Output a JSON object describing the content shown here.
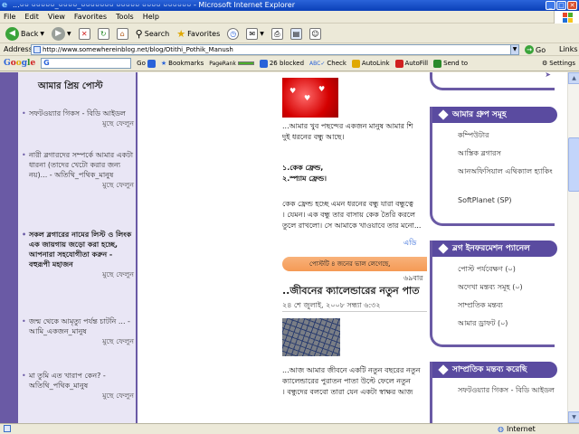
{
  "window": {
    "title": "...০০ ০০০০০_০০০০_০০০০০০০ ০০০০০ ০০০০ ০০০০০০ - Microsoft Internet Explorer",
    "minimize": "_",
    "maximize": "□",
    "close": "✕"
  },
  "menu": [
    "File",
    "Edit",
    "View",
    "Favorites",
    "Tools",
    "Help"
  ],
  "toolbar": {
    "back": "Back",
    "search": "Search",
    "favorites": "Favorites"
  },
  "address": {
    "label": "Address",
    "url": "http://www.somewhereinblog.net/blog/Otithi_Pothik_Manush",
    "go": "Go",
    "links": "Links"
  },
  "google_bar": {
    "logo": "Google",
    "search_letter": "G",
    "go": "Go",
    "bookmarks": "Bookmarks",
    "pagerank": "PageRank",
    "blocked": "26 blocked",
    "check": "Check",
    "autolink": "AutoLink",
    "autofill": "AutoFill",
    "sendto": "Send to",
    "settings": "Settings"
  },
  "left_sidebar": {
    "heading": "আমার প্রিয় পোস্ট",
    "delete_label": "মুছে ফেলুন",
    "items": [
      {
        "text": "সফটওয়্যার গিকস - বিডি আইডল",
        "bold": false
      },
      {
        "text": "নারী ব্লগারদের সম্পর্কে আমার একটা ধারনা (তাদের খেটো করার জন্য নয়)... - অতিথি_পথিক_মানুষ",
        "bold": false
      },
      {
        "text": "সকল ব্লগারের নামের লিস্ট ও লিংক এক জায়গায় জড়ো করা হচ্ছে, আপনারা সহযোগীতা করুন - বহুরূপী মহাজন",
        "bold": true
      },
      {
        "text": "জন্ম থেকে আমৃত্যু পর্যন্ত চাটনি ... - আমি_একজন_মানুষ",
        "bold": false
      },
      {
        "text": "মা তুমি এত খারাপ কেন? - অতিথি_পথিক_মানুষ",
        "bold": false
      }
    ]
  },
  "post": {
    "intro_lines": [
      "...আমার খুব পছন্দের একজন মানুষ আমার শি",
      "দুই ধরনের বন্ধু আছে।"
    ],
    "friend_types": [
      "১.কেক ফ্রেন্ড,",
      "২.স্প্যাম ফ্রেন্ড।"
    ],
    "body_lines": [
      "কেক ফ্রেন্ড হচ্ছে এমন ধরনের বন্ধু যারা বন্ধুত্বে",
      "। যেমন। এক বন্ধু তার বাসায় কেক তৈরি করলে",
      "তুলে রাখলো। সে আমাকে খাওয়াবে তার মনো..."
    ],
    "more_link": "এডি",
    "comment_bar": "পোস্টটি ৪ জনের ভাল লেগেছে,",
    "read_count": "৬৯বার",
    "post2_title": "..জীবনের ক্যালেন্ডারের নতুন পাত",
    "post2_date": "২৪ শে জুলাই, ২০০৮ সন্ধ্যা ৬:৩২",
    "post2_lines": [
      "...আজ আমার জীবনে একটি নতুন বছরের নতুন",
      "ক্যালেন্ডারের পুরাতন পাতা উল্টে ফেলে নতুন",
      "। বন্ধুদের বলবো তারা যেন একটা স্বাক্ষর আজ"
    ]
  },
  "right_sidebar": {
    "group_heading": "আমার গ্রুপ সমূহ",
    "groups": [
      "কম্পিউটার",
      "আস্তিক ব্লগারস",
      "আনঅফিসিয়াল এথিক্যাল হ্যাকিং",
      "SoftPlanet (SP)"
    ],
    "panel_heading": "ব্লগ ইনফরমেশন প্যানেল",
    "panel_items": [
      "পোস্ট পর্যবেক্ষণ (০)",
      "অদেখা মন্তব্য সমূহ (০)",
      "সাম্প্রতিক মন্তব্য",
      "আমার ড্রাফট (০)"
    ],
    "recent_heading": "সাম্প্রতিক মন্তব্য করেছি",
    "recent_items": [
      "সফটওয়্যার গিকস - বিডি আইডল"
    ]
  },
  "status": {
    "zone": "Internet"
  }
}
